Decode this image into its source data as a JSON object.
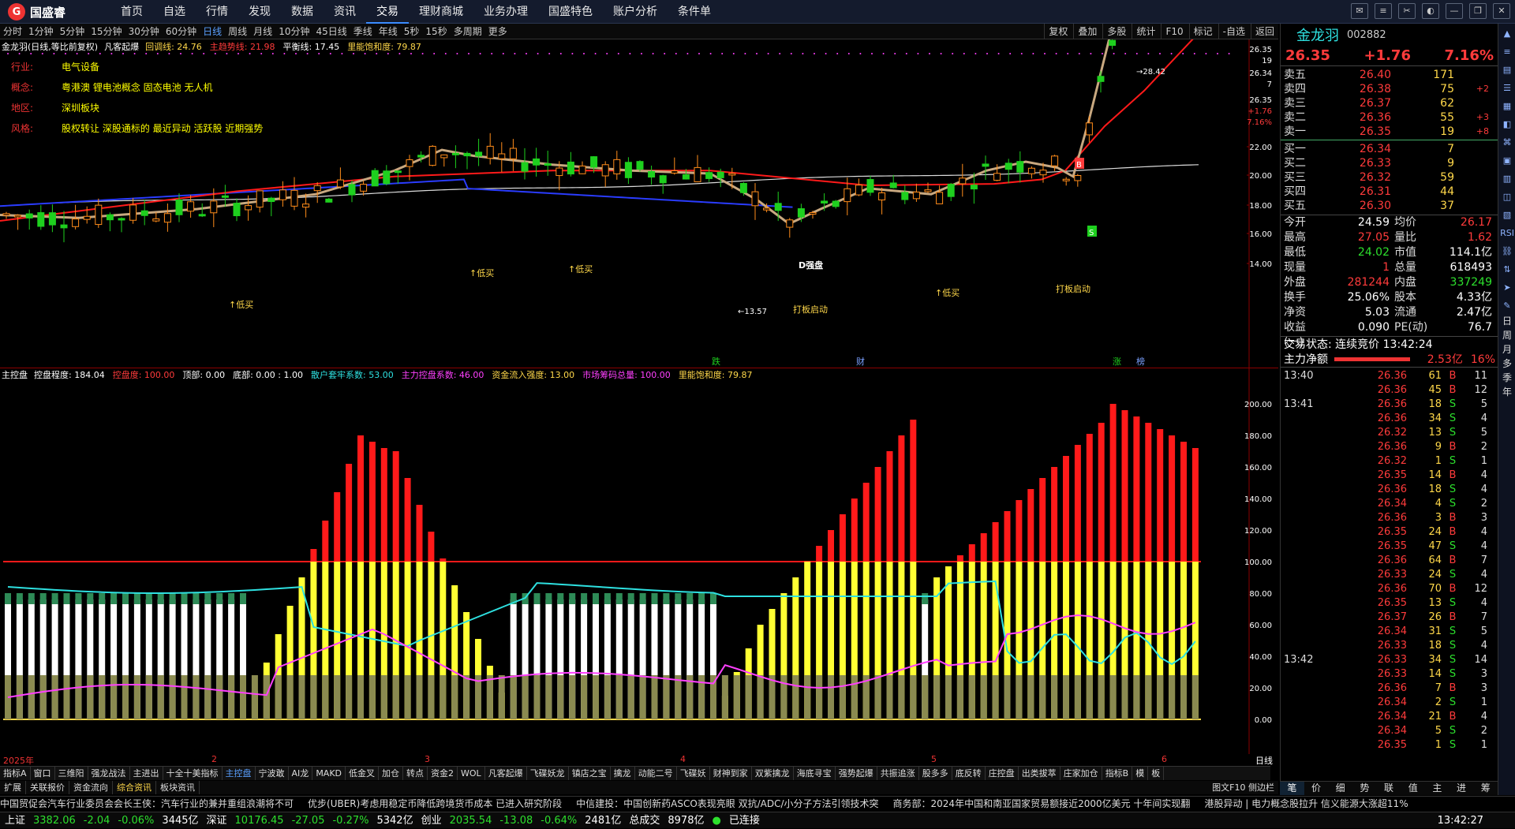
{
  "app": {
    "name": "国盛睿"
  },
  "menu": [
    "首页",
    "自选",
    "行情",
    "发现",
    "数据",
    "资讯",
    "交易",
    "理财商城",
    "业务办理",
    "国盛特色",
    "账户分析",
    "条件单"
  ],
  "menu_active": 6,
  "periods": [
    "分时",
    "1分钟",
    "5分钟",
    "15分钟",
    "30分钟",
    "60分钟",
    "日线",
    "周线",
    "月线",
    "10分钟",
    "45日线",
    "季线",
    "年线",
    "5秒",
    "15秒",
    "多周期",
    "更多"
  ],
  "period_selected": 6,
  "toolbar_right": [
    "复权",
    "叠加",
    "多股",
    "统计",
    "F10",
    "标记",
    "-自选",
    "返回"
  ],
  "chart_title": {
    "name": "金龙羽(日线,等比前复权)",
    "indicator": "凡客起爆",
    "items": [
      {
        "label": "回调线: 24.76",
        "color": "#ffd84a"
      },
      {
        "label": "主趋势线: 21.98",
        "color": "#ff3b3b"
      },
      {
        "label": "平衡线: 17.45",
        "color": "#ffffff"
      },
      {
        "label": "里能饱和度: 79.87",
        "color": "#ffd84a"
      }
    ]
  },
  "stock_info": [
    {
      "k": "行业:",
      "v": "电气设备"
    },
    {
      "k": "概念:",
      "v": "粤港澳 锂电池概念 固态电池 无人机"
    },
    {
      "k": "地区:",
      "v": "深圳板块"
    },
    {
      "k": "风格:",
      "v": "股权转让 深股通标的 最近异动 活跃股 近期强势"
    }
  ],
  "price_axis": [
    "26.35",
    "19",
    "26.34",
    "7",
    "26.35",
    "+1.76",
    "7.16%",
    "22.00",
    "20.00",
    "18.00",
    "16.00",
    "14.00"
  ],
  "chart_labels": {
    "high": "28.42",
    "low": "13.57",
    "d_label": "D强盘",
    "buy": "低买",
    "launch": "打板启动",
    "b_mark": "B",
    "s_mark": "S",
    "events": [
      "跌",
      "财",
      "涨",
      "榜"
    ]
  },
  "indicator_title": {
    "name": "主控盘",
    "items": [
      {
        "label": "控盘程度: 184.04",
        "color": "#ffffff"
      },
      {
        "label": "控盘度: 100.00",
        "color": "#ff3b3b"
      },
      {
        "label": "顶部: 0.00",
        "color": "#ffffff"
      },
      {
        "label": "底部: 0.00 : 1.00",
        "color": "#ffffff"
      },
      {
        "label": "散户套牢系数: 53.00",
        "color": "#2ee0e0"
      },
      {
        "label": "主力控盘系数: 46.00",
        "color": "#ff40ff"
      },
      {
        "label": "资金流入强度: 13.00",
        "color": "#ffd84a"
      },
      {
        "label": "市场筹码总量: 100.00",
        "color": "#ff40ff"
      },
      {
        "label": "里能饱和度: 79.87",
        "color": "#ffd84a"
      }
    ]
  },
  "sub_axis": [
    "200.00",
    "180.00",
    "160.00",
    "140.00",
    "120.00",
    "100.00",
    "80.00",
    "60.00",
    "40.00",
    "20.00",
    "0.00"
  ],
  "dates": [
    "2025年",
    "2",
    "3",
    "4",
    "5",
    "6"
  ],
  "axis_corner": "日线",
  "tabs1": [
    "指标A",
    "窗口",
    "三维阳",
    "强龙战法",
    "主进出",
    "十全十美指标",
    "主控盘",
    "宁波敢",
    "AI龙",
    "MAKD",
    "低金叉",
    "加仓",
    "转点",
    "资金2",
    "WOL",
    "凡客起爆",
    "飞碟妖龙",
    "镇店之宝",
    "擒龙",
    "动能二号",
    "飞碟妖",
    "财神到家",
    "双紫擒龙",
    "海底寻宝",
    "强势起爆",
    "共振追涨",
    "股多多",
    "底反转",
    "庄控盘",
    "出类拔萃",
    "庄家加仓",
    "指标B",
    "模",
    "板"
  ],
  "tabs1_selected": 6,
  "tabs2": [
    "扩展",
    "关联报价",
    "资金流向",
    "综合资讯",
    "板块资讯"
  ],
  "tabs2_selected": 3,
  "tabs2_right": "图文F10 侧边栏",
  "news": [
    "中国贸促会汽车行业委员会会长王侠：汽车行业的兼并重组浪潮将不可",
    "优步(UBER)考虑用稳定币降低跨境货币成本 已进入研究阶段",
    "中信建投：中国创新药ASCO表现亮眼 双抗/ADC/小分子方法引领技术突",
    "商务部：2024年中国和南亚国家贸易额接近2000亿美元 十年间实现翻",
    "港股异动 | 电力概念股拉升 信义能源大涨超11%"
  ],
  "status": {
    "sh_label": "上证",
    "sh_val": "3382.06",
    "sh_chg": "-2.04",
    "sh_pct": "-0.06%",
    "sh_amt": "3445亿",
    "sz_label": "深证",
    "sz_val": "10176.45",
    "sz_chg": "-27.05",
    "sz_pct": "-0.27%",
    "sz_amt": "5342亿",
    "cy_label": "创业",
    "cy_val": "2035.54",
    "cy_chg": "-13.08",
    "cy_pct": "-0.64%",
    "cy_amt": "2481亿",
    "total_label": "总成交",
    "total_val": "8978亿",
    "conn": "已连接",
    "time": "13:42:27"
  },
  "quote": {
    "name": "金龙羽",
    "code": "002882",
    "price": "26.35",
    "change": "+1.76",
    "pct": "7.16%",
    "asks": [
      {
        "l": "卖五",
        "p": "26.40",
        "v": "171",
        "c": ""
      },
      {
        "l": "卖四",
        "p": "26.38",
        "v": "75",
        "c": "+2"
      },
      {
        "l": "卖三",
        "p": "26.37",
        "v": "62",
        "c": ""
      },
      {
        "l": "卖二",
        "p": "26.36",
        "v": "55",
        "c": "+3"
      },
      {
        "l": "卖一",
        "p": "26.35",
        "v": "19",
        "c": "+8"
      }
    ],
    "bids": [
      {
        "l": "买一",
        "p": "26.34",
        "v": "7",
        "c": ""
      },
      {
        "l": "买二",
        "p": "26.33",
        "v": "9",
        "c": ""
      },
      {
        "l": "买三",
        "p": "26.32",
        "v": "59",
        "c": ""
      },
      {
        "l": "买四",
        "p": "26.31",
        "v": "44",
        "c": ""
      },
      {
        "l": "买五",
        "p": "26.30",
        "v": "37",
        "c": ""
      }
    ],
    "stats": [
      {
        "a": "今开",
        "b": "24.59",
        "bc": "wh",
        "c": "均价",
        "d": "26.17",
        "dc": "up"
      },
      {
        "a": "最高",
        "b": "27.05",
        "bc": "up",
        "c": "量比",
        "d": "1.62",
        "dc": "up"
      },
      {
        "a": "最低",
        "b": "24.02",
        "bc": "dn",
        "c": "市值",
        "d": "114.1亿",
        "dc": "wh"
      },
      {
        "a": "现量",
        "b": "1",
        "bc": "up",
        "c": "总量",
        "d": "618493",
        "dc": "wh"
      },
      {
        "a": "外盘",
        "b": "281244",
        "bc": "up",
        "c": "内盘",
        "d": "337249",
        "dc": "dn"
      },
      {
        "a": "换手",
        "b": "25.06%",
        "bc": "wh",
        "c": "股本",
        "d": "4.33亿",
        "dc": "wh"
      },
      {
        "a": "净资",
        "b": "5.03",
        "bc": "wh",
        "c": "流通",
        "d": "2.47亿",
        "dc": "wh"
      },
      {
        "a": "收益(一)",
        "b": "0.090",
        "bc": "wh",
        "c": "PE(动)",
        "d": "76.7",
        "dc": "wh"
      }
    ],
    "trade_state_label": "交易状态:",
    "trade_state": "连续竞价",
    "trade_time": "13:42:24",
    "net_label": "主力净额",
    "net_val": "2.53亿",
    "net_pct": "16%",
    "ticks": [
      {
        "t": "13:40",
        "p": "26.36",
        "v": "61",
        "s": "B",
        "n": "11"
      },
      {
        "t": "",
        "p": "26.36",
        "v": "45",
        "s": "B",
        "n": "12"
      },
      {
        "t": "13:41",
        "p": "26.36",
        "v": "18",
        "s": "S",
        "n": "5"
      },
      {
        "t": "",
        "p": "26.36",
        "v": "34",
        "s": "S",
        "n": "4"
      },
      {
        "t": "",
        "p": "26.32",
        "v": "13",
        "s": "S",
        "n": "5"
      },
      {
        "t": "",
        "p": "26.36",
        "v": "9",
        "s": "B",
        "n": "2"
      },
      {
        "t": "",
        "p": "26.32",
        "v": "1",
        "s": "S",
        "n": "1"
      },
      {
        "t": "",
        "p": "26.35",
        "v": "14",
        "s": "B",
        "n": "4"
      },
      {
        "t": "",
        "p": "26.36",
        "v": "18",
        "s": "S",
        "n": "4"
      },
      {
        "t": "",
        "p": "26.34",
        "v": "4",
        "s": "S",
        "n": "2"
      },
      {
        "t": "",
        "p": "26.36",
        "v": "3",
        "s": "B",
        "n": "3"
      },
      {
        "t": "",
        "p": "26.35",
        "v": "24",
        "s": "B",
        "n": "4"
      },
      {
        "t": "",
        "p": "26.35",
        "v": "47",
        "s": "S",
        "n": "4"
      },
      {
        "t": "",
        "p": "26.36",
        "v": "64",
        "s": "B",
        "n": "7"
      },
      {
        "t": "",
        "p": "26.33",
        "v": "24",
        "s": "S",
        "n": "4"
      },
      {
        "t": "",
        "p": "26.36",
        "v": "70",
        "s": "B",
        "n": "12"
      },
      {
        "t": "",
        "p": "26.35",
        "v": "13",
        "s": "S",
        "n": "4"
      },
      {
        "t": "",
        "p": "26.37",
        "v": "26",
        "s": "B",
        "n": "7"
      },
      {
        "t": "",
        "p": "26.34",
        "v": "31",
        "s": "S",
        "n": "5"
      },
      {
        "t": "",
        "p": "26.33",
        "v": "18",
        "s": "S",
        "n": "4"
      },
      {
        "t": "13:42",
        "p": "26.33",
        "v": "34",
        "s": "S",
        "n": "14"
      },
      {
        "t": "",
        "p": "26.33",
        "v": "14",
        "s": "S",
        "n": "3"
      },
      {
        "t": "",
        "p": "26.36",
        "v": "7",
        "s": "B",
        "n": "3"
      },
      {
        "t": "",
        "p": "26.34",
        "v": "2",
        "s": "S",
        "n": "1"
      },
      {
        "t": "",
        "p": "26.34",
        "v": "21",
        "s": "B",
        "n": "4"
      },
      {
        "t": "",
        "p": "26.34",
        "v": "5",
        "s": "S",
        "n": "2"
      },
      {
        "t": "",
        "p": "26.35",
        "v": "1",
        "s": "S",
        "n": "1"
      }
    ],
    "bottom_tabs": [
      "笔",
      "价",
      "细",
      "势",
      "联",
      "值",
      "主",
      "进",
      "筹"
    ],
    "bottom_selected": 0
  },
  "sidebar": {
    "icons": [
      "collapse-up-icon",
      "chart-list-icon",
      "rsi-icon",
      "menu-icon",
      "grid-icon",
      "note-icon",
      "ctrl-icon",
      "layout-icon",
      "book-icon",
      "pen-icon",
      "vol-icon",
      "rsi2-icon",
      "link-icon",
      "up-down-icon",
      "pointer-icon",
      "edit-icon"
    ],
    "icon_glyphs": [
      "▲",
      "≡",
      "▤",
      "☰",
      "▦",
      "◧",
      "⌘",
      "▣",
      "▥",
      "◫",
      "▧",
      "RSI",
      "⛓",
      "⇅",
      "➤",
      "✎"
    ],
    "text": [
      "日",
      "周",
      "月",
      "多",
      "季",
      "年"
    ]
  }
}
